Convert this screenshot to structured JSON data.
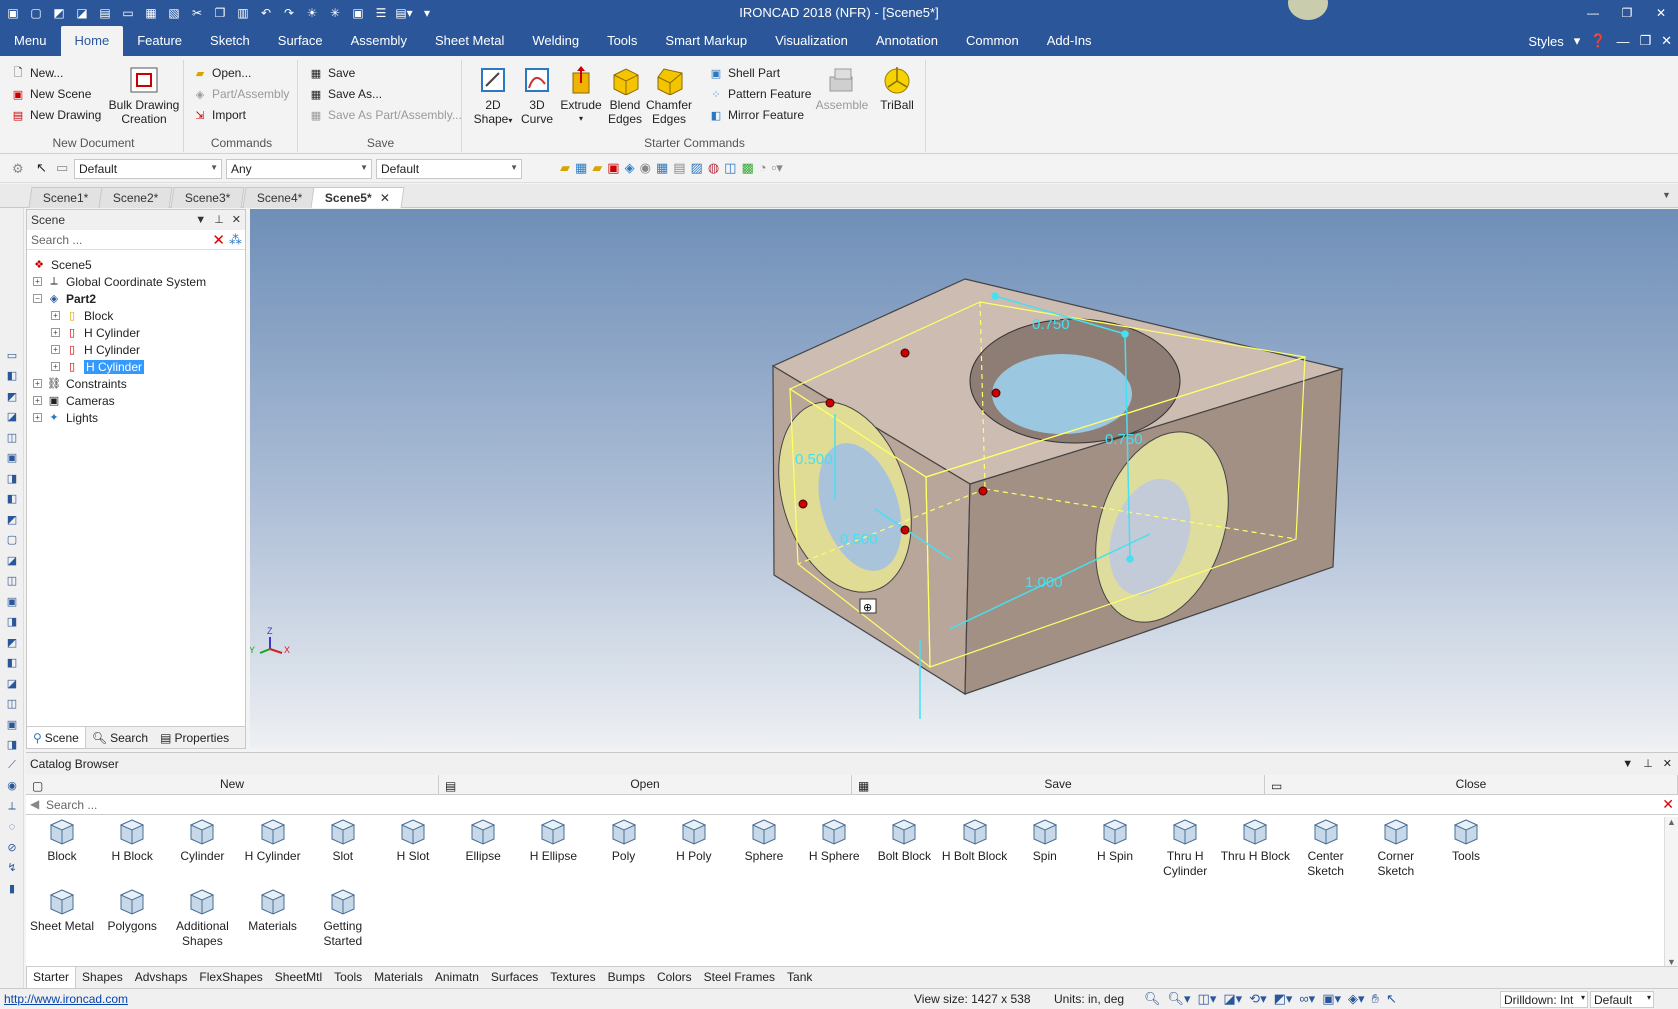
{
  "window": {
    "title": "IRONCAD 2018 (NFR) - [Scene5*]"
  },
  "menubar": {
    "tabs": [
      "Menu",
      "Home",
      "Feature",
      "Sketch",
      "Surface",
      "Assembly",
      "Sheet Metal",
      "Welding",
      "Tools",
      "Smart Markup",
      "Visualization",
      "Annotation",
      "Common",
      "Add-Ins"
    ],
    "active": "Home",
    "styles_label": "Styles"
  },
  "ribbon": {
    "new_document": {
      "label": "New Document",
      "new": "New...",
      "new_scene": "New Scene",
      "new_drawing": "New Drawing",
      "bulk_line1": "Bulk Drawing",
      "bulk_line2": "Creation"
    },
    "commands": {
      "label": "Commands",
      "open": "Open...",
      "part_assembly": "Part/Assembly",
      "import": "Import"
    },
    "save": {
      "label": "Save",
      "save": "Save",
      "save_as": "Save As...",
      "save_as_part": "Save As Part/Assembly..."
    },
    "starter": {
      "label": "Starter Commands",
      "shape2d_1": "2D",
      "shape2d_2": "Shape",
      "curve3d_1": "3D",
      "curve3d_2": "Curve",
      "extrude": "Extrude",
      "blend_1": "Blend",
      "blend_2": "Edges",
      "chamfer_1": "Chamfer",
      "chamfer_2": "Edges",
      "shell": "Shell Part",
      "pattern": "Pattern Feature",
      "mirror": "Mirror Feature",
      "assemble": "Assemble",
      "triball": "TriBall"
    }
  },
  "toolbar": {
    "combo1": "Default",
    "combo2": "Any",
    "combo3": "Default"
  },
  "doc_tabs": [
    "Scene1*",
    "Scene2*",
    "Scene3*",
    "Scene4*",
    "Scene5*"
  ],
  "scene_panel": {
    "title": "Scene",
    "search_placeholder": "Search ...",
    "tree": {
      "root": "Scene5",
      "gcs": "Global Coordinate System",
      "part": "Part2",
      "block": "Block",
      "cyl1": "H Cylinder",
      "cyl2": "H Cylinder",
      "cyl3": "H Cylinder",
      "constraints": "Constraints",
      "cameras": "Cameras",
      "lights": "Lights"
    },
    "tabs": {
      "scene": "Scene",
      "search": "Search",
      "properties": "Properties"
    }
  },
  "viewport": {
    "dims": {
      "top": "0.750",
      "right": "0.750",
      "left": "0.500",
      "mid": "0.500",
      "bottom": "1.000"
    },
    "axis": {
      "z": "Z",
      "y": "Y",
      "x": "X"
    }
  },
  "catalog": {
    "title": "Catalog Browser",
    "actions": {
      "new": "New",
      "open": "Open",
      "save": "Save",
      "close": "Close"
    },
    "search_placeholder": "Search ...",
    "items_row1": [
      {
        "line1": "Block",
        "line2": ""
      },
      {
        "line1": "H Block",
        "line2": ""
      },
      {
        "line1": "Cylinder",
        "line2": ""
      },
      {
        "line1": "H Cylinder",
        "line2": ""
      },
      {
        "line1": "Slot",
        "line2": ""
      },
      {
        "line1": "H Slot",
        "line2": ""
      },
      {
        "line1": "Ellipse",
        "line2": ""
      },
      {
        "line1": "H Ellipse",
        "line2": ""
      },
      {
        "line1": "Poly",
        "line2": ""
      },
      {
        "line1": "H Poly",
        "line2": ""
      },
      {
        "line1": "Sphere",
        "line2": ""
      },
      {
        "line1": "H Sphere",
        "line2": ""
      },
      {
        "line1": "Bolt Block",
        "line2": ""
      },
      {
        "line1": "H Bolt Block",
        "line2": ""
      },
      {
        "line1": "Spin",
        "line2": ""
      },
      {
        "line1": "H Spin",
        "line2": ""
      },
      {
        "line1": "Thru H",
        "line2": "Cylinder"
      },
      {
        "line1": "Thru H Block",
        "line2": ""
      },
      {
        "line1": "Center",
        "line2": "Sketch"
      },
      {
        "line1": "Corner",
        "line2": "Sketch"
      },
      {
        "line1": "Tools",
        "line2": ""
      }
    ],
    "items_row2": [
      {
        "line1": "Sheet Metal",
        "line2": ""
      },
      {
        "line1": "Polygons",
        "line2": ""
      },
      {
        "line1": "Additional",
        "line2": "Shapes"
      },
      {
        "line1": "Materials",
        "line2": ""
      },
      {
        "line1": "Getting",
        "line2": "Started"
      }
    ],
    "bottom_tabs": [
      "Starter",
      "Shapes",
      "Advshaps",
      "FlexShapes",
      "SheetMtl",
      "Tools",
      "Materials",
      "Animatn",
      "Surfaces",
      "Textures",
      "Bumps",
      "Colors",
      "Steel Frames",
      "Tank"
    ]
  },
  "status": {
    "url": "http://www.ironcad.com",
    "view_size": "View size: 1427 x  538",
    "units": "Units: in, deg",
    "drilldown": "Drilldown: Int",
    "default": "Default"
  },
  "colors": {
    "brand": "#2b579a",
    "selection": "#3399ff",
    "dimension": "#46e0f0",
    "highlight": "#ffff66"
  }
}
